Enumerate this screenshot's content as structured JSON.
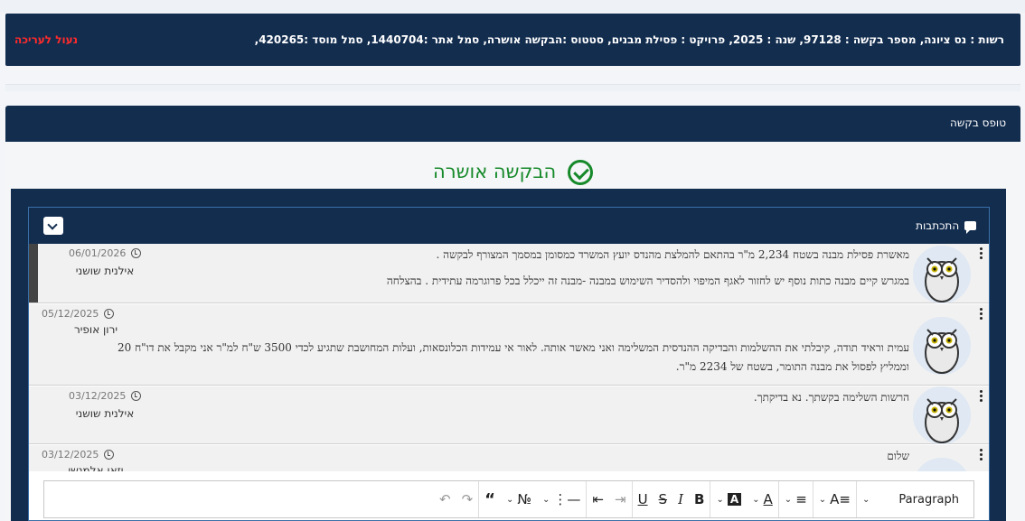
{
  "info_bar": {
    "details": "רשות : נס ציונה,  מספר בקשה : 97128,  שנה : 2025,  פרויקט : פסילת מבנים,  סטטוס :הבקשה אושרה,  סמל אתר :1440704,  סמל מוסד :420265,",
    "locked_label": "נעול לעריכה",
    "locked_color": "#ff2b2b"
  },
  "form": {
    "title": "טופס בקשה",
    "status_message": "הבקשה אושרה",
    "status_color": "#168a2a"
  },
  "comments_panel": {
    "title": "התכתבות",
    "comments": [
      {
        "lines": [
          "מאשרת פסילת מבנה בשטח 2,234 מ\"ר בהתאם להמלצת מהנדס יועץ המשרד כמסומן במסמך המצורף לבקשה .",
          "במגרש קיים מבנה כתות נוסף יש לחזור לאגף המיפוי  ולהסדיר השימוש במבנה -מבנה זה  ייכלל בכל פרוגרמה עתידית . בהצלחה"
        ],
        "date": "06/01/2026",
        "author": "אילנית שושני"
      },
      {
        "lines": [
          "עמית וראיד תודה, קיבלתי את ההשלמות והבדיקה ההנדסית המשלימה ואני מאשר אותה. לאור אי עמידות הכלונסאות, ועלות המחושבת שתגיע לכדי 3500 ש\"ח למ\"ר אני מקבל את דו\"ח 20",
          "וממליץ לפסול את מבנה התומר, בשטח של 2234 מ\"ר."
        ],
        "date": "05/12/2025",
        "author": "ירון אופיר"
      },
      {
        "lines": [
          "הרשות השלימה בקשתך. נא בדיקתך."
        ],
        "date": "03/12/2025",
        "author": "אילנית שושני"
      },
      {
        "lines": [
          "שלום"
        ],
        "date": "03/12/2025",
        "author": "יזאן אלמנשי"
      }
    ]
  },
  "editor": {
    "block_format": "Paragraph"
  }
}
